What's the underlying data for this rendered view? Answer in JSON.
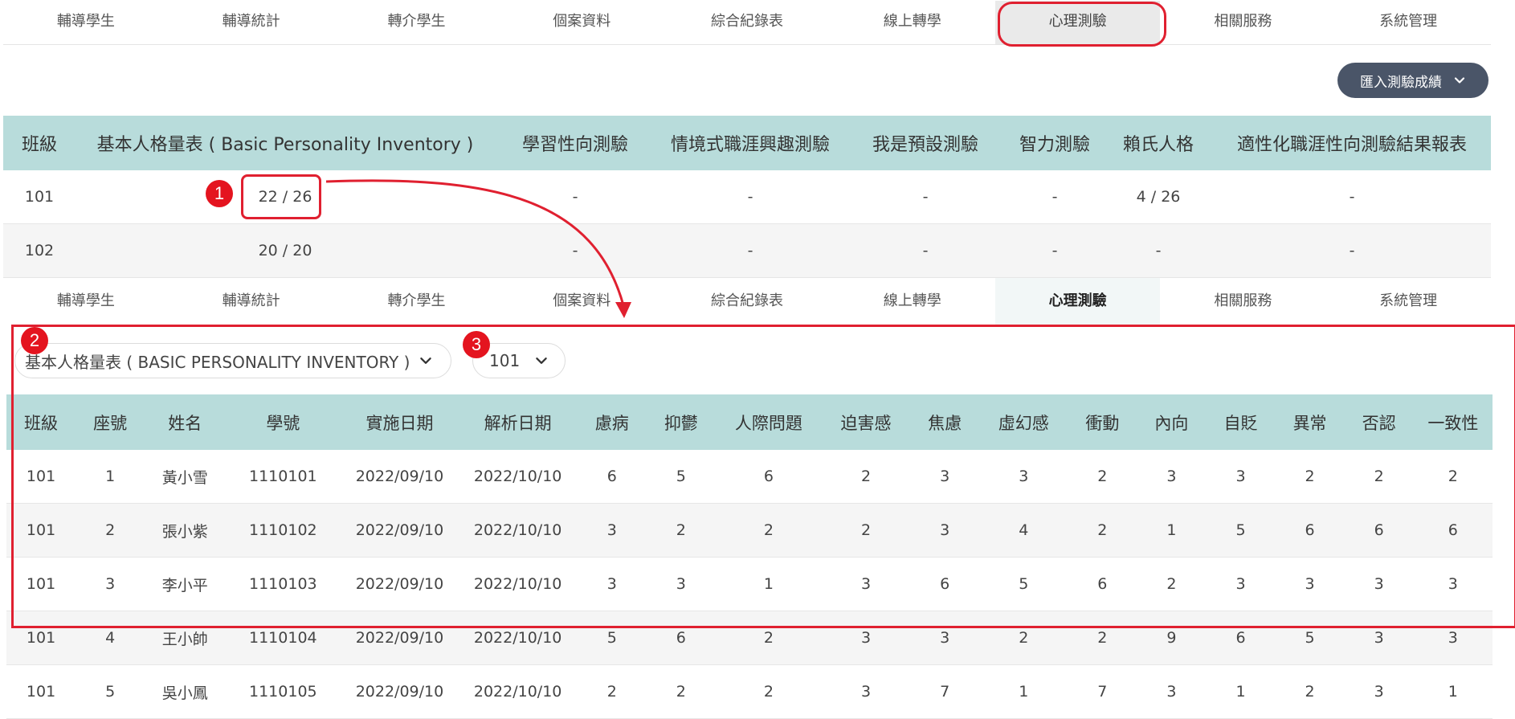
{
  "nav_top": {
    "items": [
      "輔導學生",
      "輔導統計",
      "轉介學生",
      "個案資料",
      "綜合紀錄表",
      "線上轉學",
      "心理測驗",
      "相關服務",
      "系統管理"
    ],
    "active_index": 6
  },
  "import_button": {
    "label": "匯入測驗成績",
    "icon": "chevron-down-icon"
  },
  "summary_table": {
    "headers": [
      "班級",
      "基本人格量表 ( Basic Personality Inventory )",
      "學習性向測驗",
      "情境式職涯興趣測驗",
      "我是預設測驗",
      "智力測驗",
      "賴氏人格",
      "適性化職涯性向測驗結果報表"
    ],
    "rows": [
      [
        "101",
        "22 / 26",
        "-",
        "-",
        "-",
        "-",
        "4 / 26",
        "-"
      ],
      [
        "102",
        "20 / 20",
        "-",
        "-",
        "-",
        "-",
        "-",
        "-"
      ]
    ]
  },
  "nav_bottom": {
    "items": [
      "輔導學生",
      "輔導統計",
      "轉介學生",
      "個案資料",
      "綜合紀錄表",
      "線上轉學",
      "心理測驗",
      "相關服務",
      "系統管理"
    ],
    "active_index": 6
  },
  "filters": {
    "test_select": "基本人格量表 ( BASIC PERSONALITY INVENTORY )",
    "class_select": "101"
  },
  "detail_table": {
    "headers": [
      "班級",
      "座號",
      "姓名",
      "學號",
      "實施日期",
      "解析日期",
      "慮病",
      "抑鬱",
      "人際問題",
      "迫害感",
      "焦慮",
      "虛幻感",
      "衝動",
      "內向",
      "自貶",
      "異常",
      "否認",
      "一致性"
    ],
    "rows": [
      [
        "101",
        "1",
        "黃小雪",
        "1110101",
        "2022/09/10",
        "2022/10/10",
        "6",
        "5",
        "6",
        "2",
        "3",
        "3",
        "2",
        "3",
        "3",
        "2",
        "2",
        "2"
      ],
      [
        "101",
        "2",
        "張小紫",
        "1110102",
        "2022/09/10",
        "2022/10/10",
        "3",
        "2",
        "2",
        "2",
        "3",
        "4",
        "2",
        "1",
        "5",
        "6",
        "6",
        "6"
      ],
      [
        "101",
        "3",
        "李小平",
        "1110103",
        "2022/09/10",
        "2022/10/10",
        "3",
        "3",
        "1",
        "3",
        "6",
        "5",
        "6",
        "2",
        "3",
        "3",
        "3",
        "3"
      ],
      [
        "101",
        "4",
        "王小帥",
        "1110104",
        "2022/09/10",
        "2022/10/10",
        "5",
        "6",
        "2",
        "3",
        "3",
        "2",
        "2",
        "9",
        "6",
        "5",
        "3",
        "3"
      ],
      [
        "101",
        "5",
        "吳小鳳",
        "1110105",
        "2022/09/10",
        "2022/10/10",
        "2",
        "2",
        "2",
        "3",
        "7",
        "1",
        "7",
        "3",
        "1",
        "2",
        "3",
        "1"
      ]
    ]
  },
  "annotations": {
    "badges": [
      "1",
      "2",
      "3"
    ],
    "color": "#e02030"
  }
}
